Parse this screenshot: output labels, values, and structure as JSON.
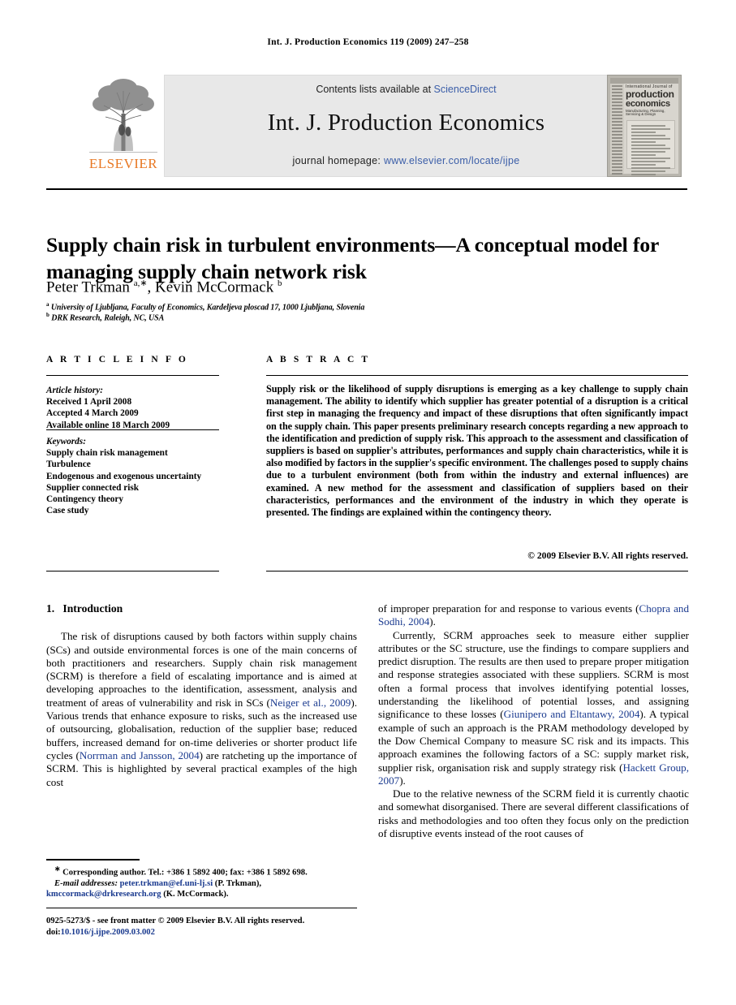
{
  "running_head": "Int. J. Production Economics 119 (2009) 247–258",
  "masthead": {
    "contents_prefix": "Contents lists available at ",
    "sciencedirect": "ScienceDirect",
    "journal_title": "Int. J. Production Economics",
    "homepage_prefix": "journal homepage: ",
    "homepage_url": "www.elsevier.com/locate/ijpe",
    "publisher_wordmark": "ELSEVIER",
    "publisher_color": "#E87722",
    "link_color": "#3b5ea8"
  },
  "cover": {
    "line1": "International Journal of",
    "line2": "production",
    "line3": "economics",
    "line4": "Manufacturing, Planning, Servicing & Design"
  },
  "article": {
    "title": "Supply chain risk in turbulent environments—A conceptual model for managing supply chain network risk",
    "authors_html": "Peter Trkman <sup>a,∗</sup>, Kevin McCormack <sup>b</sup>",
    "affiliation_a_marker": "a",
    "affiliation_a": "University of Ljubljana, Faculty of Economics, Kardeljeva ploscad 17, 1000 Ljubljana, Slovenia",
    "affiliation_b_marker": "b",
    "affiliation_b": "DRK Research, Raleigh, NC, USA"
  },
  "info": {
    "heading": "A R T I C L E  I N F O",
    "history_label": "Article history:",
    "history": [
      "Received 1 April 2008",
      "Accepted 4 March 2009",
      "Available online 18 March 2009"
    ],
    "keywords_label": "Keywords:",
    "keywords": [
      "Supply chain risk management",
      "Turbulence",
      "Endogenous and exogenous uncertainty",
      "Supplier connected risk",
      "Contingency theory",
      "Case study"
    ]
  },
  "abstract": {
    "heading": "A B S T R A C T",
    "text": "Supply risk or the likelihood of supply disruptions is emerging as a key challenge to supply chain management. The ability to identify which supplier has greater potential of a disruption is a critical first step in managing the frequency and impact of these disruptions that often significantly impact on the supply chain. This paper presents preliminary research concepts regarding a new approach to the identification and prediction of supply risk. This approach to the assessment and classification of suppliers is based on supplier's attributes, performances and supply chain characteristics, while it is also modified by factors in the supplier's specific environment. The challenges posed to supply chains due to a turbulent environment (both from within the industry and external influences) are examined. A new method for the assessment and classification of suppliers based on their characteristics, performances and the environment of the industry in which they operate is presented. The findings are explained within the contingency theory.",
    "copyright": "© 2009 Elsevier B.V. All rights reserved."
  },
  "body": {
    "section_number": "1.",
    "section_title": "Introduction",
    "left": [
      {
        "segments": [
          {
            "t": "The risk of disruptions caused by both factors within supply chains (SCs) and outside environmental forces is one of the main concerns of both practitioners and researchers. Supply chain risk management (SCRM) is therefore a field of escalating importance and is aimed at developing approaches to the identification, assessment, analysis and treatment of areas of vulnerability and risk in SCs (",
            "c": false
          },
          {
            "t": "Neiger et al., 2009",
            "c": true
          },
          {
            "t": "). Various trends that enhance exposure to risks, such as the increased use of outsourcing, globalisation, reduction of the supplier base; reduced buffers, increased demand for on-time deliveries or shorter product life cycles (",
            "c": false
          },
          {
            "t": "Norrman and Jansson, 2004",
            "c": true
          },
          {
            "t": ") are ratcheting up the importance of SCRM. This is highlighted by several practical examples of the high cost",
            "c": false
          }
        ]
      }
    ],
    "right": [
      {
        "no_indent": true,
        "segments": [
          {
            "t": "of improper preparation for and response to various events (",
            "c": false
          },
          {
            "t": "Chopra and Sodhi, 2004",
            "c": true
          },
          {
            "t": ").",
            "c": false
          }
        ]
      },
      {
        "segments": [
          {
            "t": "Currently, SCRM approaches seek to measure either supplier attributes or the SC structure, use the findings to compare suppliers and predict disruption. The results are then used to prepare proper mitigation and response strategies associated with these suppliers. SCRM is most often a formal process that involves identifying potential losses, understanding the likelihood of potential losses, and assigning significance to these losses (",
            "c": false
          },
          {
            "t": "Giunipero and Eltantawy, 2004",
            "c": true
          },
          {
            "t": "). A typical example of such an approach is the PRAM methodology developed by the Dow Chemical Company to measure SC risk and its impacts. This approach examines the following factors of a SC: supply market risk, supplier risk, organisation risk and supply strategy risk (",
            "c": false
          },
          {
            "t": "Hackett Group, 2007",
            "c": true
          },
          {
            "t": ").",
            "c": false
          }
        ]
      },
      {
        "segments": [
          {
            "t": "Due to the relative newness of the SCRM field it is currently chaotic and somewhat disorganised. There are several different classifications of risks and methodologies and too often they focus only on the prediction of disruptive events instead of the root causes of",
            "c": false
          }
        ]
      }
    ]
  },
  "footnote": {
    "marker": "∗",
    "corresponding": "Corresponding author. Tel.: +386 1 5892 400; fax: +386 1 5892 698.",
    "email_label": "E-mail addresses:",
    "email_1": "peter.trkman@ef.uni-lj.si",
    "email_1_name": " (P. Trkman),",
    "email_2": "kmccormack@drkresearch.org",
    "email_2_name": " (K. McCormack)."
  },
  "imprint": {
    "front_matter": "0925-5273/$ - see front matter © 2009 Elsevier B.V. All rights reserved.",
    "doi_label": "doi:",
    "doi": "10.1016/j.ijpe.2009.03.002"
  }
}
